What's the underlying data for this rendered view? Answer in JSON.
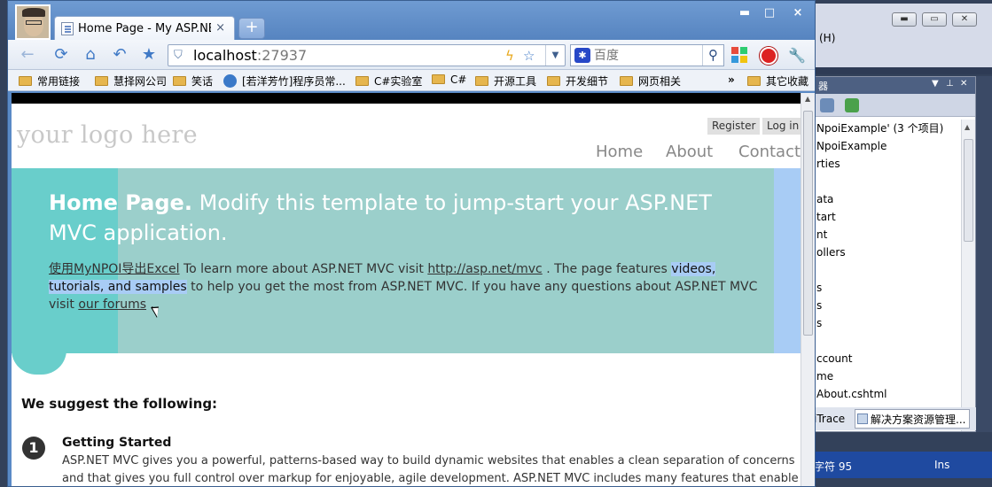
{
  "ide": {
    "menu_item": "(H)",
    "panel_title": "器",
    "tree_items": [
      "NpoiExample' (3 个项目)",
      "NpoiExample",
      "rties",
      "",
      "ata",
      "tart",
      "nt",
      "ollers",
      "",
      "s",
      "s",
      "s",
      "",
      "ccount",
      "me",
      "About.cshtml"
    ],
    "tab_intellitrace": "iTrace",
    "tab_solution": "解决方案资源管理...",
    "status_chars": "字符 95",
    "status_ins": "Ins"
  },
  "browser": {
    "tab_title": "Home Page - My ASP.NET",
    "tab_close": "×",
    "new_tab": "+",
    "window_controls": [
      "▬",
      "□",
      "×"
    ],
    "url_host": "localhost",
    "url_port": ":27937",
    "search_placeholder": "百度",
    "search_engine": "baidu",
    "bookmarks": [
      "常用链接",
      "慧择网公司",
      "笑话",
      "[若洋芳竹]程序员常...",
      "C#实验室",
      "C#",
      "开源工具",
      "开发细节",
      "网页相关",
      "其它收藏"
    ],
    "bookmark_overflow": "»"
  },
  "page": {
    "logo": "your logo here",
    "register": "Register",
    "login": "Log in",
    "nav": [
      "Home",
      "About",
      "Contact"
    ],
    "hero_title_bold": "Home Page.",
    "hero_title_rest": "Modify this template to jump-start your ASP.NET MVC application.",
    "hero_link_npoi": "使用MyNPOI导出Excel",
    "hero_text_1": "To learn more about ASP.NET MVC visit",
    "hero_link_asp": "http://asp.net/mvc",
    "hero_text_2": ". The page features",
    "hero_highlight": "videos, tutorials, and samples",
    "hero_text_3": "to help you get the most from ASP.NET MVC. If you have any questions about ASP.NET MVC visit",
    "hero_link_forums": "our forums",
    "hero_text_4": ".",
    "suggest_heading": "We suggest the following:",
    "step_number": "1",
    "step_title": "Getting Started",
    "step_body": "ASP.NET MVC gives you a powerful, patterns-based way to build dynamic websites that enables a clean separation of concerns and that gives you full control over markup for enjoyable, agile development. ASP.NET MVC includes many features that enable fast, TDD-friendly"
  },
  "colors": {
    "hero_bg": "#9bcfcb",
    "hero_accent": "#69cecb",
    "highlight": "#a8ccf5",
    "browser_chrome": "#5a8ac6"
  }
}
